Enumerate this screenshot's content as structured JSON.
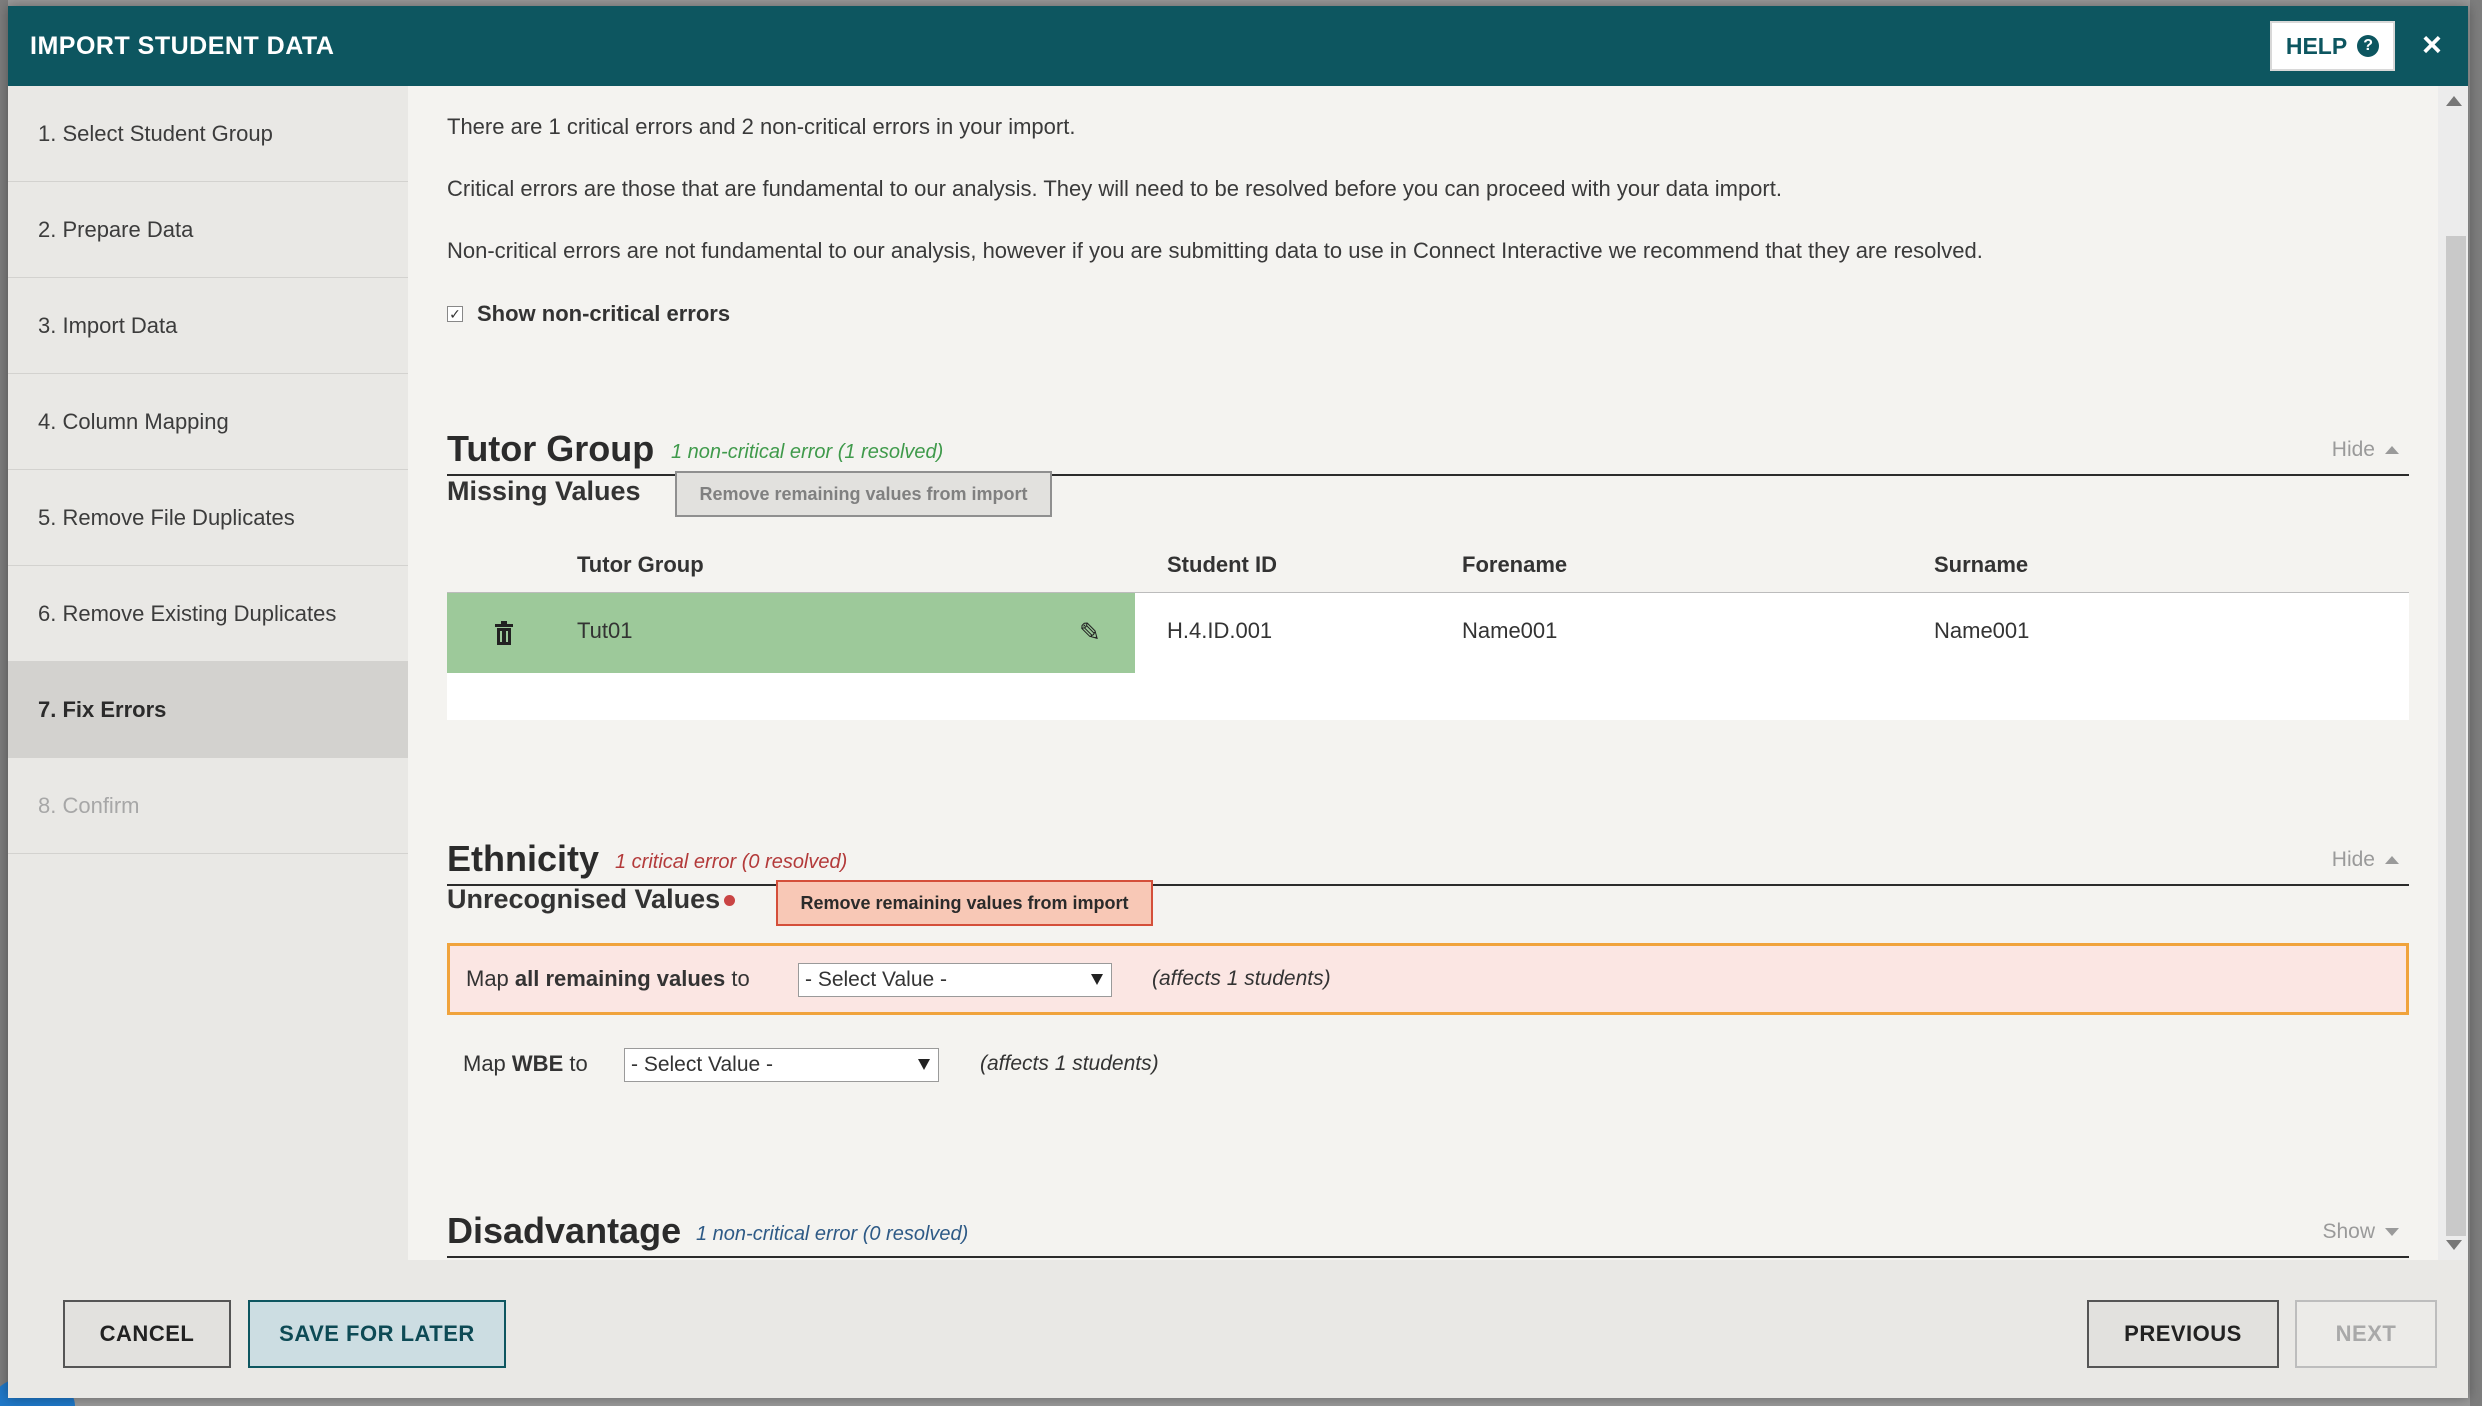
{
  "header": {
    "title": "IMPORT STUDENT DATA",
    "help_label": "HELP",
    "close_label": "×"
  },
  "sidebar": {
    "steps": [
      {
        "label": "1. Select Student Group"
      },
      {
        "label": "2. Prepare Data"
      },
      {
        "label": "3. Import Data"
      },
      {
        "label": "4. Column Mapping"
      },
      {
        "label": "5. Remove File Duplicates"
      },
      {
        "label": "6. Remove Existing Duplicates"
      },
      {
        "label": "7. Fix Errors"
      },
      {
        "label": "8. Confirm"
      }
    ]
  },
  "intro": {
    "summary": "There are 1 critical errors and 2 non-critical errors in your import.",
    "critical_desc": "Critical errors are those that are fundamental to our analysis. They will need to be resolved before you can proceed with your data import.",
    "noncritical_desc": "Non-critical errors are not fundamental to our analysis, however if you are submitting data to use in Connect Interactive we recommend that they are resolved.",
    "show_noncritical_label": "Show non-critical errors",
    "show_noncritical_checked": true
  },
  "tutor_group": {
    "title": "Tutor Group",
    "status": "1 non-critical error (1 resolved)",
    "toggle": "Hide",
    "subsection": "Missing Values",
    "remove_button": "Remove remaining values from import",
    "columns": [
      "Tutor Group",
      "Student ID",
      "Forename",
      "Surname"
    ],
    "rows": [
      {
        "tutor_group": "Tut01",
        "student_id": "H.4.ID.001",
        "forename": "Name001",
        "surname": "Name001"
      }
    ]
  },
  "ethnicity": {
    "title": "Ethnicity",
    "status": "1 critical error (0 resolved)",
    "toggle": "Hide",
    "subsection": "Unrecognised Values",
    "remove_button": "Remove remaining values from import",
    "map_all": {
      "prefix": "Map ",
      "bold": "all remaining values",
      "suffix": " to",
      "select_value": "- Select Value -",
      "affects": "(affects 1 students)"
    },
    "map_wbe": {
      "prefix": "Map ",
      "bold": "WBE",
      "suffix": " to",
      "select_value": "- Select Value -",
      "affects": "(affects 1 students)"
    }
  },
  "disadvantage": {
    "title": "Disadvantage",
    "status": "1 non-critical error (0 resolved)",
    "toggle": "Show"
  },
  "footer": {
    "cancel": "CANCEL",
    "save_later": "SAVE FOR LATER",
    "previous": "PREVIOUS",
    "next": "NEXT"
  },
  "colors": {
    "header_bg": "#0d5660",
    "resolved_row": "#9dc99a",
    "critical": "#b33a3a",
    "non_critical": "#3f9a4b",
    "warning_border": "#f0a33c"
  }
}
